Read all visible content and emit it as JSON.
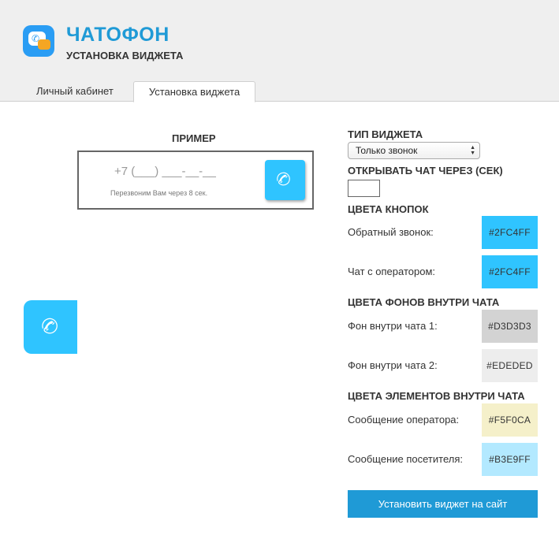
{
  "app": {
    "brand": "ЧАТОФОН",
    "subtitle": "УСТАНОВКА ВИДЖЕТА"
  },
  "tabs": [
    {
      "label": "Личный кабинет",
      "active": false
    },
    {
      "label": "Установка виджета",
      "active": true
    }
  ],
  "example": {
    "title": "ПРИМЕР",
    "phone_placeholder": "+7 (___) ___-__-__",
    "note": "Перезвоним Вам через 8 сек."
  },
  "widget_type": {
    "title": "ТИП ВИДЖЕТА",
    "selected": "Только звонок"
  },
  "open_chat": {
    "title": "ОТКРЫВАТЬ ЧАТ ЧЕРЕЗ (СЕК)",
    "value": ""
  },
  "button_colors": {
    "title": "ЦВЕТА КНОПОК",
    "rows": [
      {
        "label": "Обратный звонок:",
        "value": "#2FC4FF",
        "color": "#2FC4FF"
      },
      {
        "label": "Чат с оператором:",
        "value": "#2FC4FF",
        "color": "#2FC4FF"
      }
    ]
  },
  "bg_colors": {
    "title": "ЦВЕТА ФОНОВ ВНУТРИ ЧАТА",
    "rows": [
      {
        "label": "Фон внутри чата 1:",
        "value": "#D3D3D3",
        "color": "#D3D3D3"
      },
      {
        "label": "Фон внутри чата 2:",
        "value": "#EDEDED",
        "color": "#EDEDED"
      }
    ]
  },
  "element_colors": {
    "title": "ЦВЕТА ЭЛЕМЕНТОВ ВНУТРИ ЧАТА",
    "rows": [
      {
        "label": "Сообщение оператора:",
        "value": "#F5F0CA",
        "color": "#F5F0CA"
      },
      {
        "label": "Сообщение посетителя:",
        "value": "#B3E9FF",
        "color": "#B3E9FF"
      }
    ]
  },
  "install_button": "Установить виджет на сайт",
  "colors": {
    "accent": "#1F9AD6",
    "widget_button": "#2FC4FF",
    "header_bg": "#EFEFEF"
  },
  "icons": {
    "logo": "chat-bubbles-phone-icon",
    "call": "phone-handset-icon",
    "select": "select-arrows-icon"
  }
}
